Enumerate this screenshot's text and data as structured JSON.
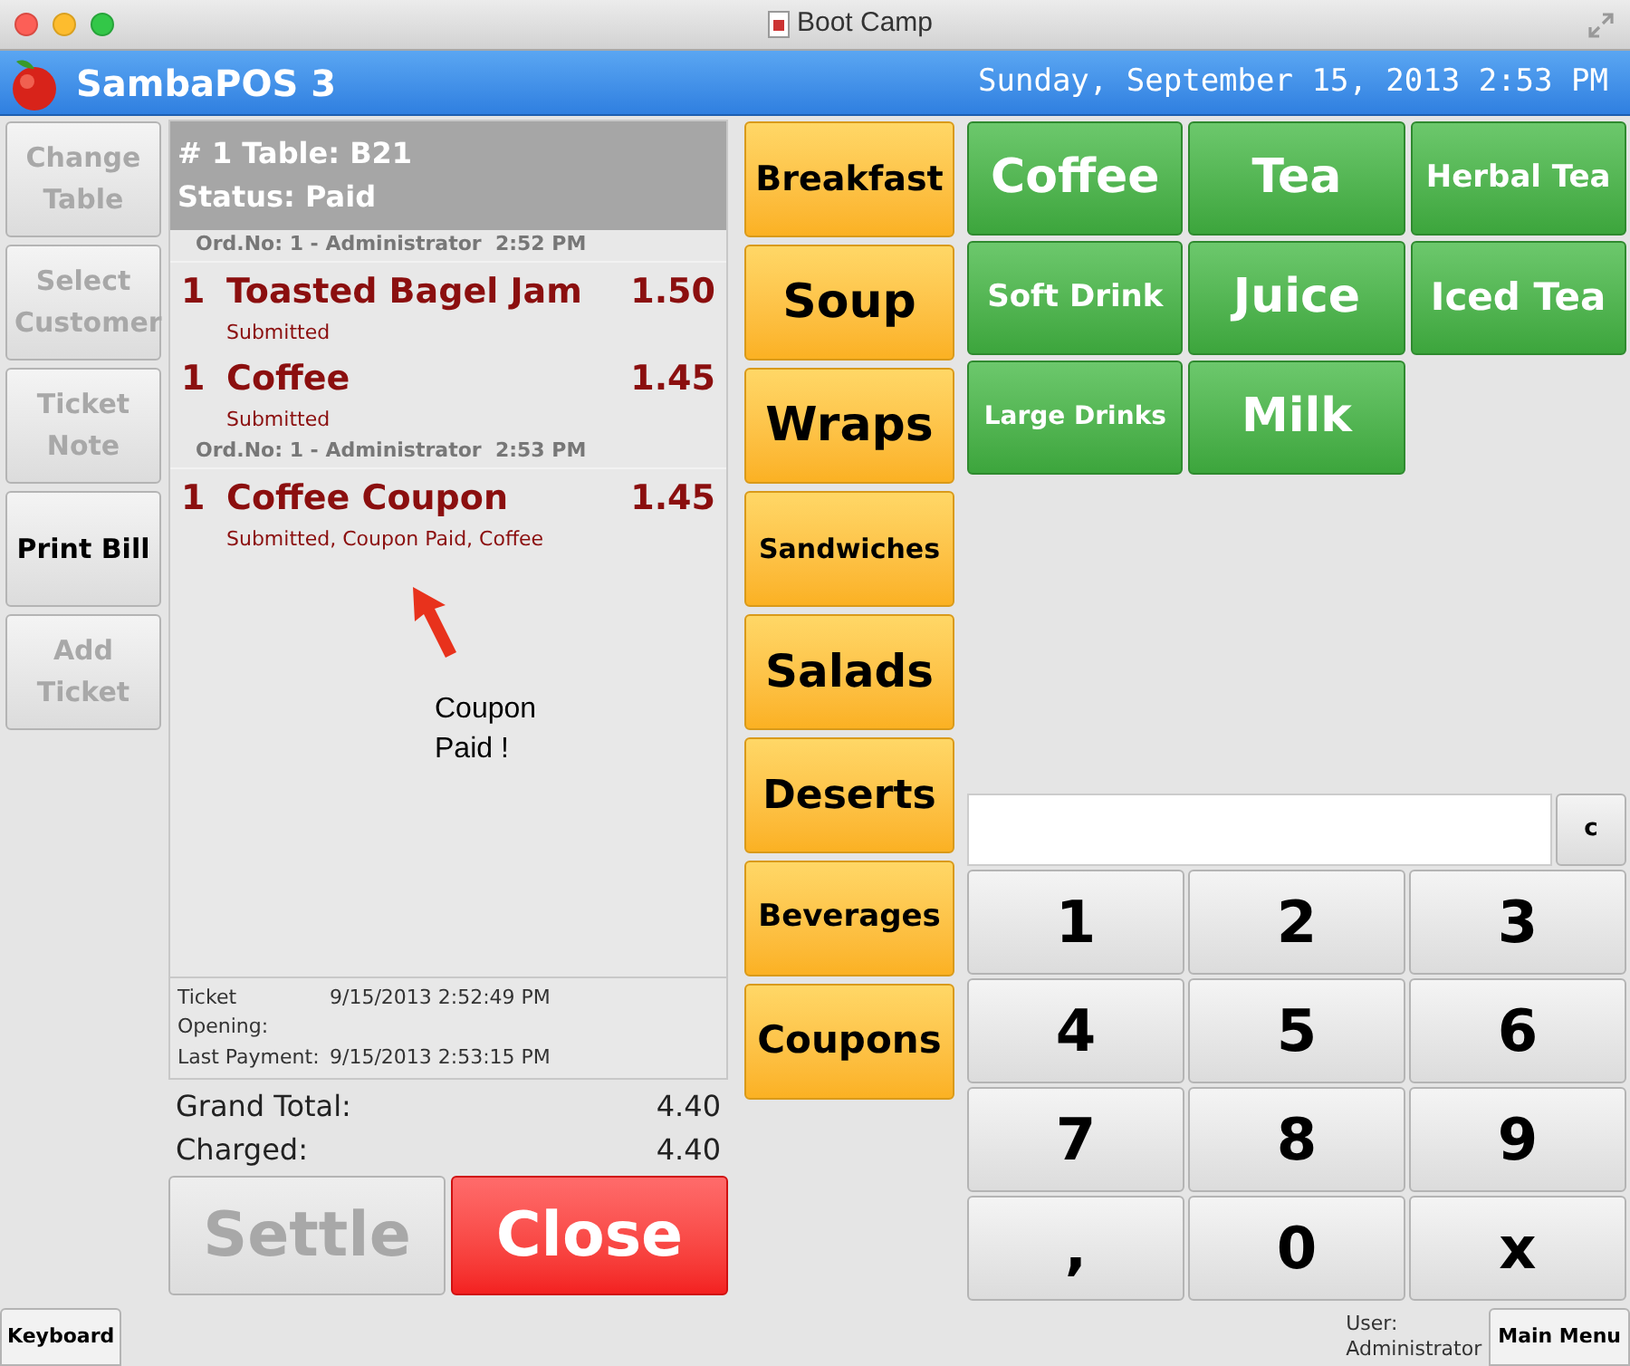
{
  "window": {
    "title": "Boot Camp"
  },
  "header": {
    "app_name": "SambaPOS 3",
    "datetime": "Sunday, September 15, 2013 2:53 PM"
  },
  "left_buttons": [
    {
      "label": "Change Table",
      "disabled": true
    },
    {
      "label": "Select Customer",
      "disabled": true
    },
    {
      "label": "Ticket Note",
      "disabled": true
    },
    {
      "label": "Print Bill",
      "disabled": false
    },
    {
      "label": "Add Ticket",
      "disabled": true
    }
  ],
  "ticket": {
    "title": "# 1 Table: B21",
    "status": "Status: Paid",
    "groups": [
      {
        "header": "Ord.No: 1 - Administrator  2:52 PM",
        "orders": [
          {
            "qty": "1",
            "name": "Toasted Bagel Jam",
            "price": "1.50",
            "states": "Submitted"
          },
          {
            "qty": "1",
            "name": "Coffee",
            "price": "1.45",
            "states": "Submitted"
          }
        ]
      },
      {
        "header": "Ord.No: 1 - Administrator  2:53 PM",
        "orders": [
          {
            "qty": "1",
            "name": "Coffee Coupon",
            "price": "1.45",
            "states": "Submitted, Coupon Paid, Coffee"
          }
        ]
      }
    ],
    "annotation": "Coupon Paid !",
    "footer": [
      {
        "label": "Ticket Opening:",
        "value": "9/15/2013 2:52:49 PM"
      },
      {
        "label": "Last Payment:",
        "value": "9/15/2013 2:53:15 PM"
      }
    ],
    "totals": [
      {
        "label": "Grand Total:",
        "value": "4.40"
      },
      {
        "label": "Charged:",
        "value": "4.40"
      }
    ],
    "actions": [
      {
        "label": "Settle",
        "kind": "settle",
        "disabled": true
      },
      {
        "label": "Close",
        "kind": "close",
        "disabled": false
      }
    ]
  },
  "categories": [
    "Breakfast",
    "Soup",
    "Wraps",
    "Sandwiches",
    "Salads",
    "Deserts",
    "Beverages",
    "Coupons"
  ],
  "products": [
    "Coffee",
    "Tea",
    "Herbal Tea",
    "Soft Drink",
    "Juice",
    "Iced Tea",
    "Large Drinks",
    "Milk"
  ],
  "numpad": {
    "clear": "c",
    "keys": [
      "1",
      "2",
      "3",
      "4",
      "5",
      "6",
      "7",
      "8",
      "9",
      ",",
      "0",
      "x"
    ]
  },
  "status_bar": {
    "keyboard": "Keyboard",
    "user_label": "User:",
    "user": "Administrator",
    "main_menu": "Main Menu"
  }
}
